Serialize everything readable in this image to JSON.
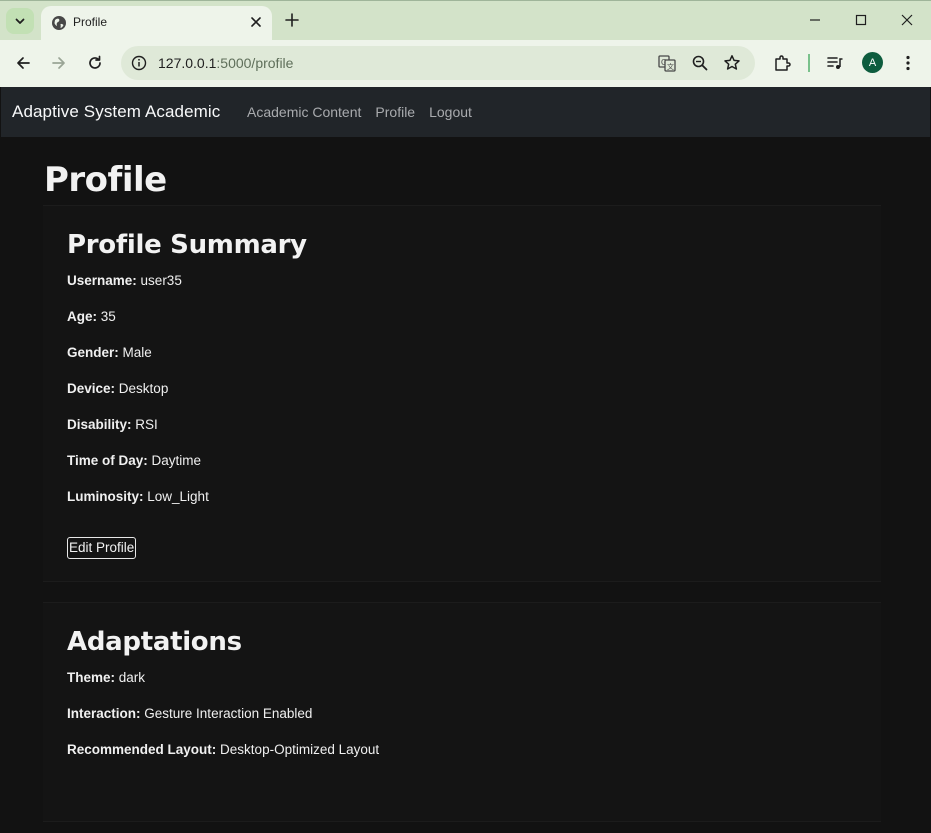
{
  "browser": {
    "tab_title": "Profile",
    "url_host": "127.0.0.1",
    "url_path": ":5000/profile",
    "avatar_letter": "A",
    "theme_color": "#d3e3c9"
  },
  "navbar": {
    "brand": "Adaptive System Academic",
    "links": [
      "Academic Content",
      "Profile",
      "Logout"
    ]
  },
  "page": {
    "title": "Profile"
  },
  "profile_summary": {
    "heading": "Profile Summary",
    "fields": [
      {
        "label": "Username:",
        "value": "user35"
      },
      {
        "label": "Age:",
        "value": "35"
      },
      {
        "label": "Gender:",
        "value": "Male"
      },
      {
        "label": "Device:",
        "value": "Desktop"
      },
      {
        "label": "Disability:",
        "value": "RSI"
      },
      {
        "label": "Time of Day:",
        "value": "Daytime"
      },
      {
        "label": "Luminosity:",
        "value": "Low_Light"
      }
    ],
    "edit_button": "Edit Profile"
  },
  "adaptations": {
    "heading": "Adaptations",
    "fields": [
      {
        "label": "Theme:",
        "value": "dark"
      },
      {
        "label": "Interaction:",
        "value": "Gesture Interaction Enabled"
      },
      {
        "label": "Recommended Layout:",
        "value": "Desktop-Optimized Layout"
      }
    ]
  }
}
